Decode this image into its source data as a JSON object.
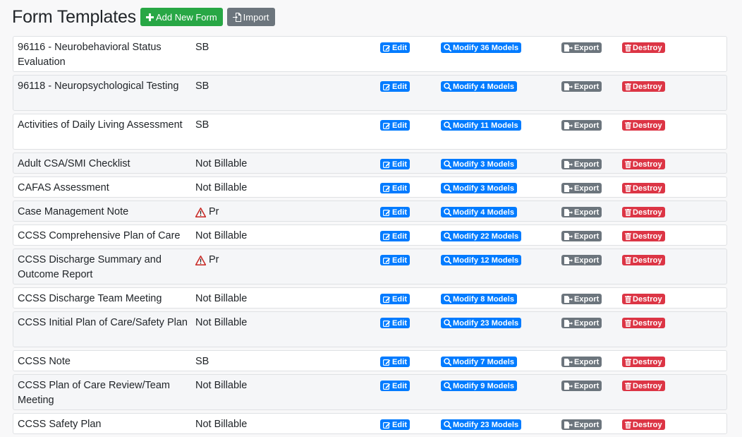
{
  "header": {
    "title": "Form Templates",
    "add_button": "Add New Form",
    "import_button": "Import"
  },
  "actions": {
    "edit": "Edit",
    "export": "Export",
    "destroy": "Destroy"
  },
  "colors": {
    "success": "#28a745",
    "primary": "#007bff",
    "secondary": "#6c757d",
    "danger": "#dc3545"
  },
  "forms": [
    {
      "name": "96116 - Neurobehavioral Status Evaluation",
      "billing": "SB",
      "warning": false,
      "modify": "Modify 36 Models",
      "tall": true
    },
    {
      "name": "96118 - Neuropsychological Testing",
      "billing": "SB",
      "warning": false,
      "modify": "Modify 4 Models",
      "tall": true
    },
    {
      "name": "Activities of Daily Living Assessment",
      "billing": "SB",
      "warning": false,
      "modify": "Modify 11 Models",
      "tall": true
    },
    {
      "name": "Adult CSA/SMI Checklist",
      "billing": "Not Billable",
      "warning": false,
      "modify": "Modify 3 Models",
      "tall": false
    },
    {
      "name": "CAFAS Assessment",
      "billing": "Not Billable",
      "warning": false,
      "modify": "Modify 3 Models",
      "tall": false
    },
    {
      "name": "Case Management Note",
      "billing": "Pr",
      "warning": true,
      "modify": "Modify 4 Models",
      "tall": false
    },
    {
      "name": "CCSS Comprehensive Plan of Care",
      "billing": "Not Billable",
      "warning": false,
      "modify": "Modify 22 Models",
      "tall": false
    },
    {
      "name": "CCSS Discharge Summary and Outcome Report",
      "billing": "Pr",
      "warning": true,
      "modify": "Modify 12 Models",
      "tall": true
    },
    {
      "name": "CCSS Discharge Team Meeting",
      "billing": "Not Billable",
      "warning": false,
      "modify": "Modify 8 Models",
      "tall": false
    },
    {
      "name": "CCSS Initial Plan of Care/Safety Plan",
      "billing": "Not Billable",
      "warning": false,
      "modify": "Modify 23 Models",
      "tall": true
    },
    {
      "name": "CCSS Note",
      "billing": "SB",
      "warning": false,
      "modify": "Modify 7 Models",
      "tall": false
    },
    {
      "name": "CCSS Plan of Care Review/Team Meeting",
      "billing": "Not Billable",
      "warning": false,
      "modify": "Modify 9 Models",
      "tall": true
    },
    {
      "name": "CCSS Safety Plan",
      "billing": "Not Billable",
      "warning": false,
      "modify": "Modify 23 Models",
      "tall": false
    }
  ]
}
